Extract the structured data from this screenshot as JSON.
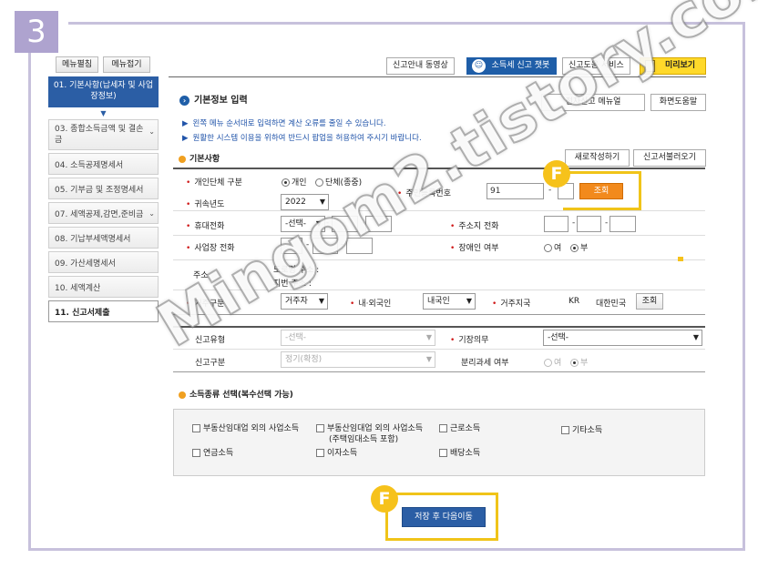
{
  "step_number": "3",
  "menu": {
    "expand": "메뉴펼침",
    "collapse": "메뉴접기"
  },
  "toolbar": {
    "video": "신고안내 동영상",
    "chatbot": "소득세 신고 챗봇",
    "help_service": "신고도움 서비스",
    "preview": "미리보기",
    "ebook_manual": "전자신고 메뉴얼",
    "screen_help": "화면도움말",
    "new_write": "새로작성하기",
    "load_report": "신고서불러오기"
  },
  "nav": {
    "items": [
      {
        "label": "01. 기본사항(납세자 및 사업장정보)",
        "active": true
      },
      {
        "label": "03. 종합소득금액 및 결손금",
        "chevron": true
      },
      {
        "label": "04. 소득공제명세서"
      },
      {
        "label": "05. 기부금 및 조정명세서"
      },
      {
        "label": "07. 세액공제,감면,준비금",
        "chevron": true
      },
      {
        "label": "08. 기납부세액명세서"
      },
      {
        "label": "09. 가산세명세서"
      },
      {
        "label": "10. 세액계산"
      },
      {
        "label": "11. 신고서제출",
        "last": true
      }
    ]
  },
  "main": {
    "title": "기본정보 입력",
    "notes": [
      "왼쪽 메뉴 순서대로 입력하면 계산 오류를 줄일 수 있습니다.",
      "원활한 시스템 이용을 위하여 반드시 팝업을 허용하여 주시기 바랍니다."
    ],
    "basic_section": "기본사항",
    "income_section": "소득종류 선택(복수선택 가능)"
  },
  "form": {
    "type_label": "개인단체 구분",
    "type_opt1": "개인",
    "type_opt2": "단체(종중)",
    "year_label": "귀속년도",
    "year_value": "2022",
    "resident_label": "주민등록번호",
    "resident_value": "91",
    "lookup_button": "조회",
    "phone_label": "휴대전화",
    "phone_value": "-선택-",
    "home_phone_label": "주소지 전화",
    "biz_phone_label": "사업장 전화",
    "disabled_label": "장애인 여부",
    "yes": "여",
    "no": "부",
    "address_label": "주소",
    "road_address": "도로명 주소 :",
    "lot_address": "지번 주소 :",
    "residence_label": "거주구분",
    "residence_value": "거주자",
    "nationality_label": "내·외국인",
    "nationality_value": "내국인",
    "country_label": "거주지국",
    "country_code": "KR",
    "country_name": "대한민국",
    "country_lookup": "조회",
    "report_type_label": "신고유형",
    "select_placeholder": "-선택-",
    "bookkeeping_label": "기장의무",
    "report_kind_label": "신고구분",
    "report_kind_value": "정기(확정)",
    "separate_tax_label": "분리과세 여부"
  },
  "income": {
    "biz_simple": "부동산임대업 외의 사업소득",
    "biz_rental": "부동산임대업 외의 사업소득",
    "biz_rental_sub": "(주택임대소득 포함)",
    "wage": "근로소득",
    "other": "기타소득",
    "pension": "연금소득",
    "interest": "이자소득",
    "dividend": "배당소득"
  },
  "save_next": "저장 후 다음이동",
  "badge_letter": "F",
  "watermark": "Mingom2.tistory.com"
}
